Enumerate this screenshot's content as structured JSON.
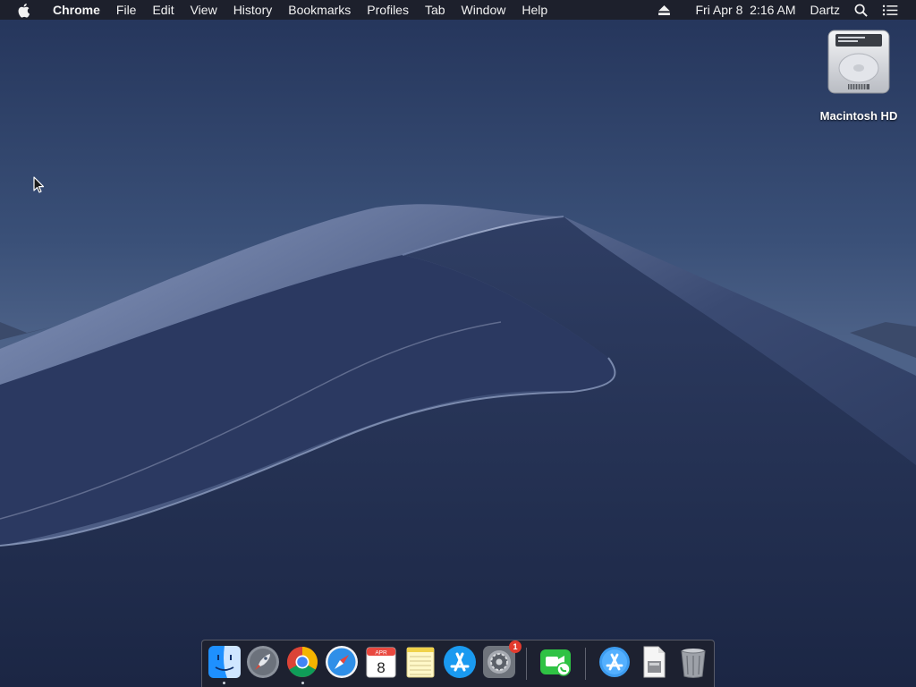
{
  "menubar": {
    "app_name": "Chrome",
    "menus": [
      "File",
      "Edit",
      "View",
      "History",
      "Bookmarks",
      "Profiles",
      "Tab",
      "Window",
      "Help"
    ],
    "datetime": "Fri Apr 8  2:16 AM",
    "user": "Dartz"
  },
  "desktop": {
    "icons": [
      {
        "label": "Macintosh HD",
        "icon": "hard-drive-icon"
      }
    ]
  },
  "dock": {
    "apps": [
      {
        "name": "finder",
        "running": true
      },
      {
        "name": "launchpad",
        "running": false
      },
      {
        "name": "chrome",
        "running": true
      },
      {
        "name": "safari",
        "running": false
      },
      {
        "name": "calendar",
        "running": false,
        "month": "APR",
        "day": "8"
      },
      {
        "name": "notes",
        "running": false
      },
      {
        "name": "app-store",
        "running": false
      },
      {
        "name": "system-preferences",
        "running": false,
        "badge": "1"
      },
      {
        "name": "facetime",
        "running": false
      },
      {
        "name": "applications-folder",
        "running": false
      },
      {
        "name": "document",
        "running": false
      },
      {
        "name": "trash",
        "running": false
      }
    ]
  }
}
